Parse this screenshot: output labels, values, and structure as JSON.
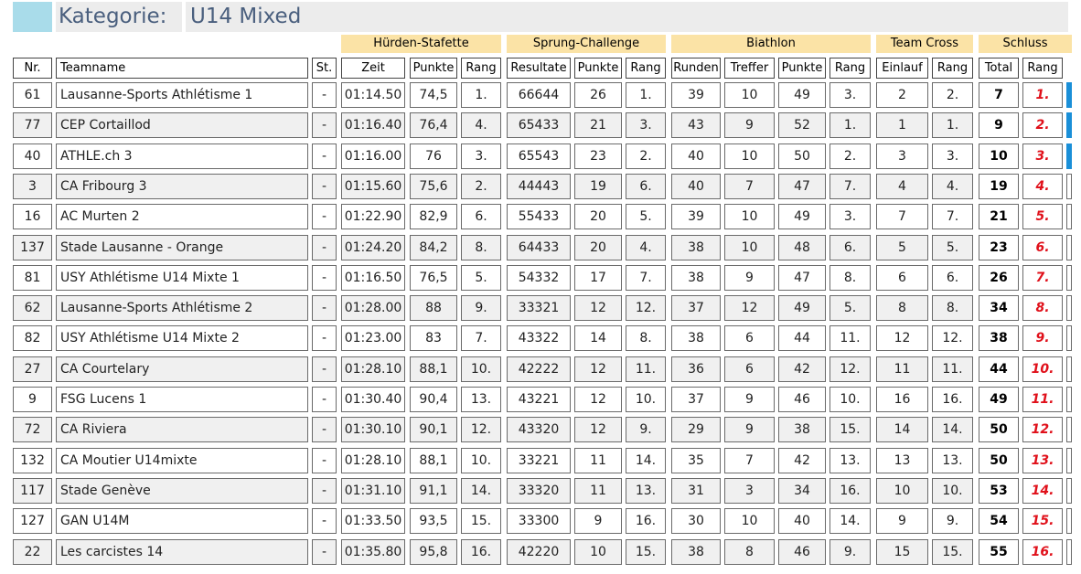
{
  "header": {
    "label": "Kategorie:",
    "value": "U14 Mixed"
  },
  "groups": [
    "Hürden-Stafette",
    "Sprung-Challenge",
    "Biathlon",
    "Team Cross",
    "Schluss"
  ],
  "columns": [
    "Nr.",
    "Teamname",
    "St.",
    "Zeit",
    "Punkte",
    "Rang",
    "Resultate",
    "Punkte",
    "Rang",
    "Runden",
    "Treffer",
    "Punkte",
    "Rang",
    "Einlauf",
    "Rang",
    "Total",
    "Rang"
  ],
  "rows": [
    {
      "nr": "61",
      "team": "Lausanne-Sports Athlétisme 1",
      "st": "-",
      "zeit": "01:14.50",
      "hp": "74,5",
      "hr": "1.",
      "res": "66644",
      "sp": "26",
      "sr": "1.",
      "runden": "39",
      "treffer": "10",
      "bp": "49",
      "br": "3.",
      "einlauf": "2",
      "tr": "2.",
      "total": "7",
      "rang": "1.",
      "flag": true
    },
    {
      "nr": "77",
      "team": "CEP Cortaillod",
      "st": "-",
      "zeit": "01:16.40",
      "hp": "76,4",
      "hr": "4.",
      "res": "65433",
      "sp": "21",
      "sr": "3.",
      "runden": "43",
      "treffer": "9",
      "bp": "52",
      "br": "1.",
      "einlauf": "1",
      "tr": "1.",
      "total": "9",
      "rang": "2.",
      "flag": true
    },
    {
      "nr": "40",
      "team": "ATHLE.ch 3",
      "st": "-",
      "zeit": "01:16.00",
      "hp": "76",
      "hr": "3.",
      "res": "65543",
      "sp": "23",
      "sr": "2.",
      "runden": "40",
      "treffer": "10",
      "bp": "50",
      "br": "2.",
      "einlauf": "3",
      "tr": "3.",
      "total": "10",
      "rang": "3.",
      "flag": true
    },
    {
      "nr": "3",
      "team": "CA Fribourg 3",
      "st": "-",
      "zeit": "01:15.60",
      "hp": "75,6",
      "hr": "2.",
      "res": "44443",
      "sp": "19",
      "sr": "6.",
      "runden": "40",
      "treffer": "7",
      "bp": "47",
      "br": "7.",
      "einlauf": "4",
      "tr": "4.",
      "total": "19",
      "rang": "4.",
      "flag": false
    },
    {
      "nr": "16",
      "team": "AC Murten 2",
      "st": "-",
      "zeit": "01:22.90",
      "hp": "82,9",
      "hr": "6.",
      "res": "55433",
      "sp": "20",
      "sr": "5.",
      "runden": "39",
      "treffer": "10",
      "bp": "49",
      "br": "3.",
      "einlauf": "7",
      "tr": "7.",
      "total": "21",
      "rang": "5.",
      "flag": false
    },
    {
      "nr": "137",
      "team": "Stade Lausanne - Orange",
      "st": "-",
      "zeit": "01:24.20",
      "hp": "84,2",
      "hr": "8.",
      "res": "64433",
      "sp": "20",
      "sr": "4.",
      "runden": "38",
      "treffer": "10",
      "bp": "48",
      "br": "6.",
      "einlauf": "5",
      "tr": "5.",
      "total": "23",
      "rang": "6.",
      "flag": false
    },
    {
      "nr": "81",
      "team": "USY Athlétisme U14 Mixte 1",
      "st": "-",
      "zeit": "01:16.50",
      "hp": "76,5",
      "hr": "5.",
      "res": "54332",
      "sp": "17",
      "sr": "7.",
      "runden": "38",
      "treffer": "9",
      "bp": "47",
      "br": "8.",
      "einlauf": "6",
      "tr": "6.",
      "total": "26",
      "rang": "7.",
      "flag": false
    },
    {
      "nr": "62",
      "team": "Lausanne-Sports Athlétisme 2",
      "st": "-",
      "zeit": "01:28.00",
      "hp": "88",
      "hr": "9.",
      "res": "33321",
      "sp": "12",
      "sr": "12.",
      "runden": "37",
      "treffer": "12",
      "bp": "49",
      "br": "5.",
      "einlauf": "8",
      "tr": "8.",
      "total": "34",
      "rang": "8.",
      "flag": false
    },
    {
      "nr": "82",
      "team": "USY Athlétisme U14 Mixte 2",
      "st": "-",
      "zeit": "01:23.00",
      "hp": "83",
      "hr": "7.",
      "res": "43322",
      "sp": "14",
      "sr": "8.",
      "runden": "38",
      "treffer": "6",
      "bp": "44",
      "br": "11.",
      "einlauf": "12",
      "tr": "12.",
      "total": "38",
      "rang": "9.",
      "flag": false
    },
    {
      "nr": "27",
      "team": "CA Courtelary",
      "st": "-",
      "zeit": "01:28.10",
      "hp": "88,1",
      "hr": "10.",
      "res": "42222",
      "sp": "12",
      "sr": "11.",
      "runden": "36",
      "treffer": "6",
      "bp": "42",
      "br": "12.",
      "einlauf": "11",
      "tr": "11.",
      "total": "44",
      "rang": "10.",
      "flag": false
    },
    {
      "nr": "9",
      "team": "FSG Lucens 1",
      "st": "-",
      "zeit": "01:30.40",
      "hp": "90,4",
      "hr": "13.",
      "res": "43221",
      "sp": "12",
      "sr": "10.",
      "runden": "37",
      "treffer": "9",
      "bp": "46",
      "br": "10.",
      "einlauf": "16",
      "tr": "16.",
      "total": "49",
      "rang": "11.",
      "flag": false
    },
    {
      "nr": "72",
      "team": "CA Riviera",
      "st": "-",
      "zeit": "01:30.10",
      "hp": "90,1",
      "hr": "12.",
      "res": "43320",
      "sp": "12",
      "sr": "9.",
      "runden": "29",
      "treffer": "9",
      "bp": "38",
      "br": "15.",
      "einlauf": "14",
      "tr": "14.",
      "total": "50",
      "rang": "12.",
      "flag": false
    },
    {
      "nr": "132",
      "team": "CA Moutier U14mixte",
      "st": "-",
      "zeit": "01:28.10",
      "hp": "88,1",
      "hr": "10.",
      "res": "33221",
      "sp": "11",
      "sr": "14.",
      "runden": "35",
      "treffer": "7",
      "bp": "42",
      "br": "13.",
      "einlauf": "13",
      "tr": "13.",
      "total": "50",
      "rang": "13.",
      "flag": false
    },
    {
      "nr": "117",
      "team": "Stade Genève",
      "st": "-",
      "zeit": "01:31.10",
      "hp": "91,1",
      "hr": "14.",
      "res": "33320",
      "sp": "11",
      "sr": "13.",
      "runden": "31",
      "treffer": "3",
      "bp": "34",
      "br": "16.",
      "einlauf": "10",
      "tr": "10.",
      "total": "53",
      "rang": "14.",
      "flag": false
    },
    {
      "nr": "127",
      "team": "GAN U14M",
      "st": "-",
      "zeit": "01:33.50",
      "hp": "93,5",
      "hr": "15.",
      "res": "33300",
      "sp": "9",
      "sr": "16.",
      "runden": "30",
      "treffer": "10",
      "bp": "40",
      "br": "14.",
      "einlauf": "9",
      "tr": "9.",
      "total": "54",
      "rang": "15.",
      "flag": false
    },
    {
      "nr": "22",
      "team": "Les carcistes 14",
      "st": "-",
      "zeit": "01:35.80",
      "hp": "95,8",
      "hr": "16.",
      "res": "42220",
      "sp": "10",
      "sr": "15.",
      "runden": "38",
      "treffer": "8",
      "bp": "46",
      "br": "9.",
      "einlauf": "15",
      "tr": "15.",
      "total": "55",
      "rang": "16.",
      "flag": false
    }
  ],
  "colors": {
    "accent": "#a9dcea",
    "group_header": "#fbe3a6",
    "rank_red": "#e0101a",
    "flag_blue": "#1a8fd8"
  }
}
